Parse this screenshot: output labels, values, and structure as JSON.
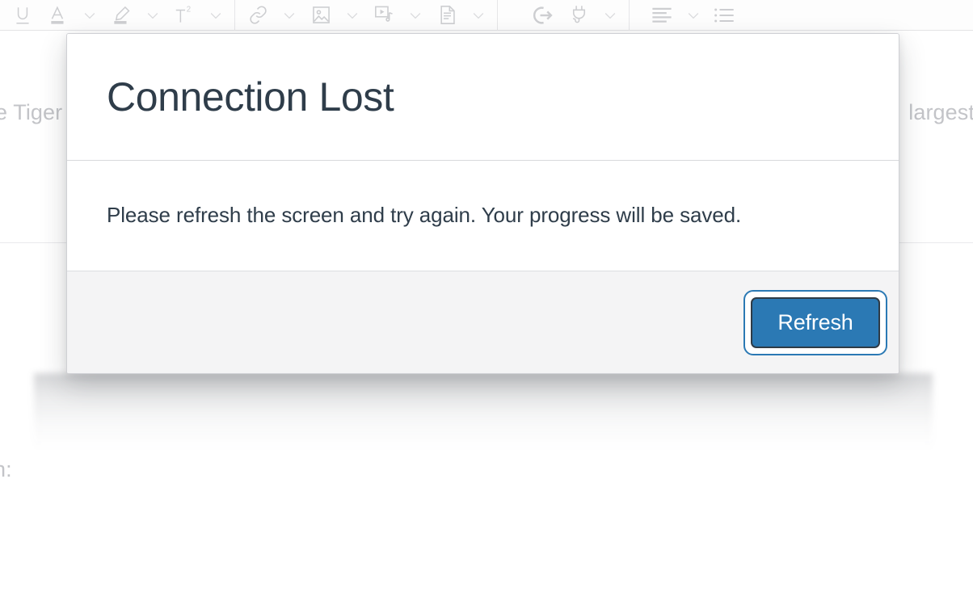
{
  "dialog": {
    "title": "Connection Lost",
    "message": "Please refresh the screen and try again. Your progress will be saved.",
    "primary_button_label": "Refresh",
    "accent_color": "#2b79b4",
    "title_color": "#2f3d4a",
    "footer_background": "#f4f4f5"
  },
  "toolbar": {
    "groups": [
      {
        "name": "formatting",
        "items": [
          {
            "icon": "underline-icon",
            "has_dropdown": false
          },
          {
            "icon": "text-color-icon",
            "has_dropdown": true
          },
          {
            "icon": "highlight-color-icon",
            "has_dropdown": true
          },
          {
            "icon": "superscript-icon",
            "has_dropdown": true
          }
        ]
      },
      {
        "name": "insert",
        "items": [
          {
            "icon": "link-icon",
            "has_dropdown": true
          },
          {
            "icon": "image-icon",
            "has_dropdown": true
          },
          {
            "icon": "media-icon",
            "has_dropdown": true
          },
          {
            "icon": "document-icon",
            "has_dropdown": true
          }
        ]
      },
      {
        "name": "embed",
        "items": [
          {
            "icon": "insert-arrow-icon",
            "has_dropdown": false
          },
          {
            "icon": "plugin-plug-icon",
            "has_dropdown": true
          }
        ]
      },
      {
        "name": "paragraph",
        "items": [
          {
            "icon": "align-left-icon",
            "has_dropdown": true
          },
          {
            "icon": "bulleted-list-icon",
            "has_dropdown": false
          }
        ]
      }
    ]
  },
  "background_document": {
    "fragment_left": "e Tiger",
    "fragment_right": "largest",
    "fragment_bottom": "n:"
  }
}
